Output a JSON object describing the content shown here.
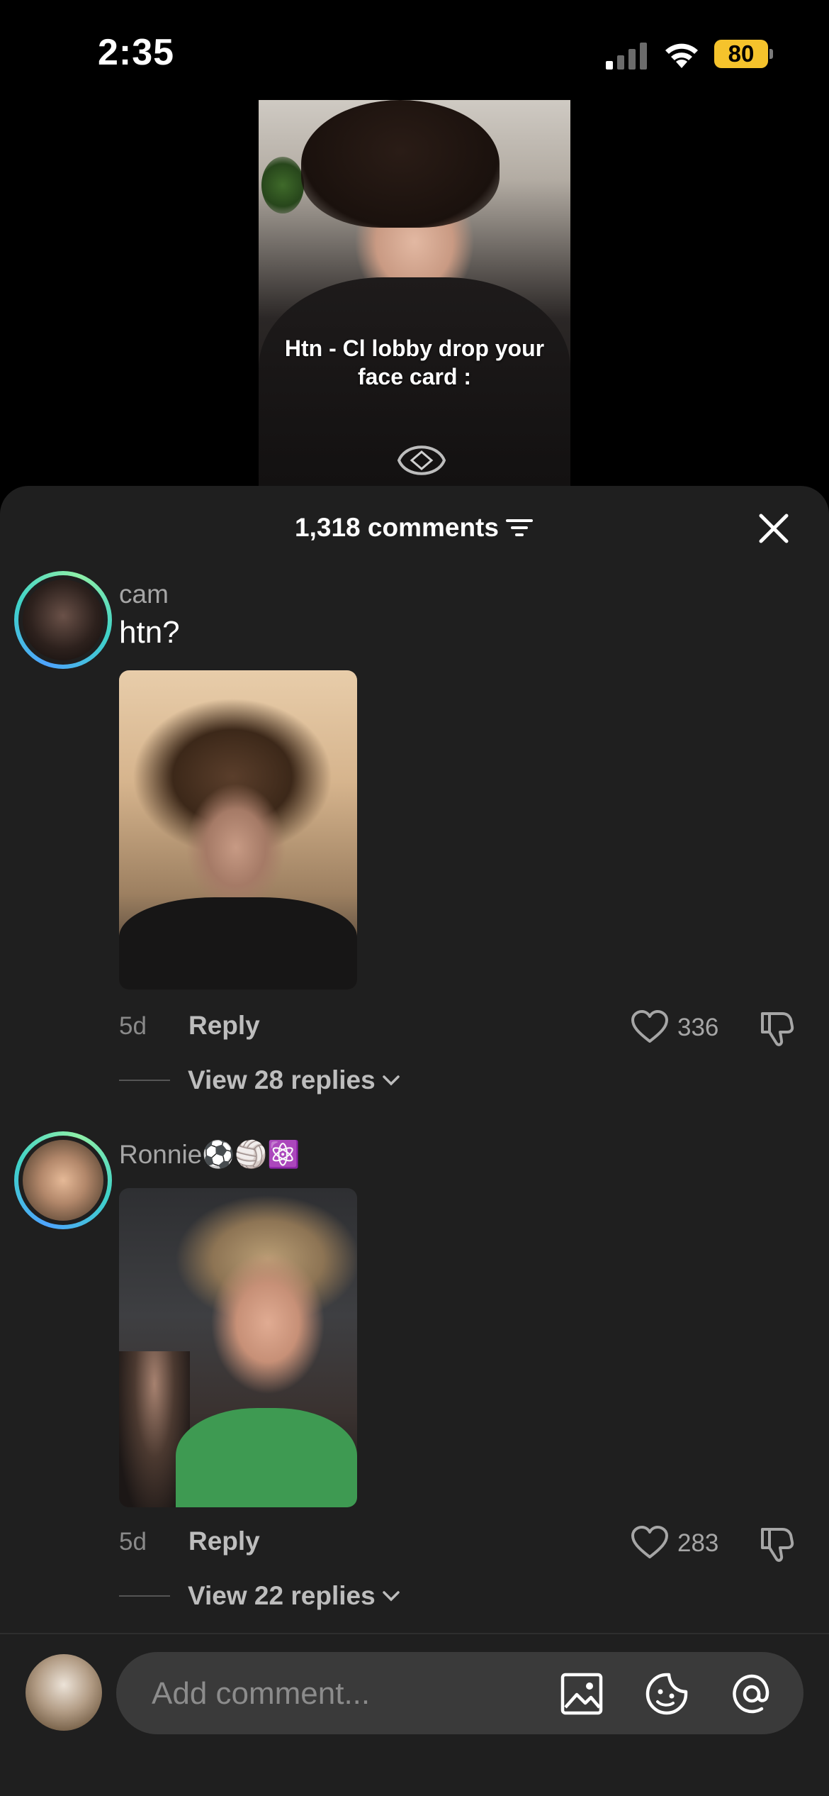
{
  "status_bar": {
    "time": "2:35",
    "battery": "80"
  },
  "video": {
    "caption": "Htn - Cl lobby drop your face card :"
  },
  "comments_panel": {
    "count_label": "1,318 comments"
  },
  "comments": [
    {
      "username": "cam",
      "text": "htn?",
      "age": "5d",
      "reply_label": "Reply",
      "likes": "336",
      "view_replies": "View 28 replies"
    },
    {
      "username": "Ronnie⚽🏐⚛️",
      "text": "",
      "age": "5d",
      "reply_label": "Reply",
      "likes": "283",
      "view_replies": "View 22 replies"
    }
  ],
  "input": {
    "placeholder": "Add comment..."
  },
  "colors": {
    "sheet_bg": "#1f1f1f",
    "battery": "#f5c32c",
    "avatar_ring": "#3fd2c8"
  },
  "icons": [
    "signal-icon",
    "wifi-icon",
    "filter-icon",
    "close-icon",
    "heart-icon",
    "thumbs-down-icon",
    "chevron-down-icon",
    "image-icon",
    "sticker-icon",
    "mention-icon"
  ]
}
